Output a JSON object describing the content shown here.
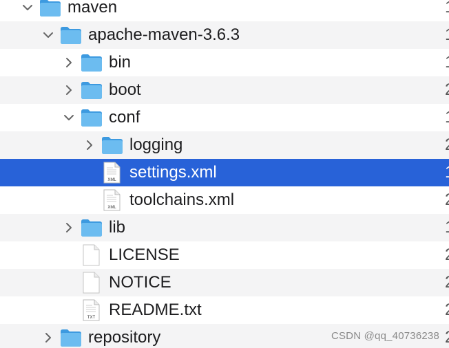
{
  "tree": {
    "rows": [
      {
        "label": "maven",
        "type": "folder",
        "expanded": true,
        "col2": "1"
      },
      {
        "label": "apache-maven-3.6.3",
        "type": "folder",
        "expanded": true,
        "col2": "1"
      },
      {
        "label": "bin",
        "type": "folder",
        "expanded": false,
        "col2": "1"
      },
      {
        "label": "boot",
        "type": "folder",
        "expanded": false,
        "col2": "2"
      },
      {
        "label": "conf",
        "type": "folder",
        "expanded": true,
        "col2": "1"
      },
      {
        "label": "logging",
        "type": "folder",
        "expanded": false,
        "col2": "2"
      },
      {
        "label": "settings.xml",
        "type": "xml",
        "selected": true,
        "badge": "XML",
        "col2": "1"
      },
      {
        "label": "toolchains.xml",
        "type": "xml",
        "badge": "XML",
        "col2": "2"
      },
      {
        "label": "lib",
        "type": "folder",
        "expanded": false,
        "col2": "1"
      },
      {
        "label": "LICENSE",
        "type": "file",
        "col2": "2"
      },
      {
        "label": "NOTICE",
        "type": "file",
        "col2": "2"
      },
      {
        "label": "README.txt",
        "type": "txt",
        "badge": "TXT",
        "col2": "2"
      },
      {
        "label": "repository",
        "type": "folder",
        "expanded": false,
        "col2": "2"
      }
    ]
  },
  "watermark": "CSDN @qq_40736238",
  "colors": {
    "selection": "#2862d8",
    "folder": "#5eb5ee",
    "alt_row": "#f4f4f5"
  }
}
